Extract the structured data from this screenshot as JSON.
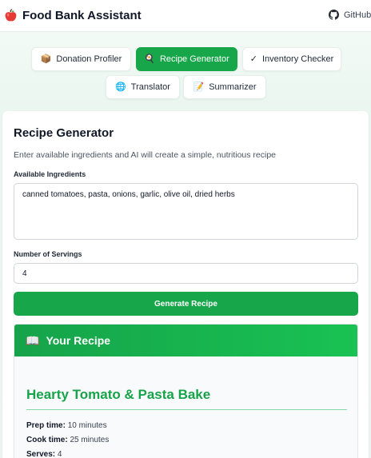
{
  "header": {
    "title": "Food Bank Assistant",
    "logo_icon": "apple-icon",
    "github_label": "GitHub"
  },
  "nav": {
    "tabs": [
      {
        "label": "Donation Profiler",
        "icon": "📦",
        "active": false
      },
      {
        "label": "Recipe Generator",
        "icon": "🍳",
        "active": true
      },
      {
        "label": "Inventory Checker",
        "icon": "✓",
        "active": false
      },
      {
        "label": "Translator",
        "icon": "🌐",
        "active": false
      },
      {
        "label": "Summarizer",
        "icon": "📝",
        "active": false
      }
    ]
  },
  "form": {
    "title": "Recipe Generator",
    "description": "Enter available ingredients and AI will create a simple, nutritious recipe",
    "ingredients_label": "Available Ingredients",
    "ingredients_value": "canned tomatoes, pasta, onions, garlic, olive oil, dried herbs",
    "servings_label": "Number of Servings",
    "servings_value": "4",
    "submit_label": "Generate Recipe"
  },
  "result": {
    "header_icon": "📖",
    "header_title": "Your Recipe",
    "recipe_title": "Hearty Tomato & Pasta Bake",
    "meta": [
      {
        "label": "Prep time:",
        "value": "10 minutes"
      },
      {
        "label": "Cook time:",
        "value": "25 minutes"
      },
      {
        "label": "Serves:",
        "value": "4"
      }
    ]
  },
  "colors": {
    "accent": "#17a64a",
    "recipe_title": "#16a34a"
  }
}
